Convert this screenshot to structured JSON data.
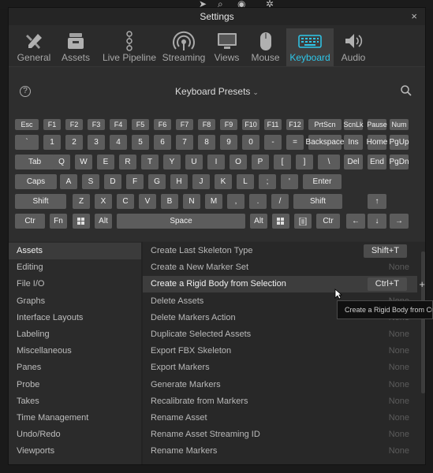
{
  "window": {
    "title": "Settings",
    "close": "×"
  },
  "tabs": [
    {
      "label": "General",
      "icon": "tools-icon"
    },
    {
      "label": "Assets",
      "icon": "assets-icon"
    },
    {
      "label": "Live Pipeline",
      "icon": "pipeline-icon"
    },
    {
      "label": "Streaming",
      "icon": "streaming-icon"
    },
    {
      "label": "Views",
      "icon": "monitor-icon"
    },
    {
      "label": "Mouse",
      "icon": "mouse-icon"
    },
    {
      "label": "Keyboard",
      "icon": "keyboard-icon",
      "active": true
    },
    {
      "label": "Audio",
      "icon": "speaker-icon"
    }
  ],
  "keyboard": {
    "help": "?",
    "presets_label": "Keyboard Presets",
    "rows": [
      [
        "Esc",
        "F1",
        "F2",
        "F3",
        "F4",
        "F5",
        "F6",
        "F7",
        "F8",
        "F9",
        "F10",
        "F11",
        "F12",
        "PrtScn",
        "ScnLk",
        "Pause",
        "Num"
      ],
      [
        "`",
        "1",
        "2",
        "3",
        "4",
        "5",
        "6",
        "7",
        "8",
        "9",
        "0",
        "-",
        "=",
        "Backspace",
        "Ins",
        "Home",
        "PgUp"
      ],
      [
        "Tab",
        "Q",
        "W",
        "E",
        "R",
        "T",
        "Y",
        "U",
        "I",
        "O",
        "P",
        "[",
        "]",
        "\\",
        "Del",
        "End",
        "PgDn"
      ],
      [
        "Caps",
        "A",
        "S",
        "D",
        "F",
        "G",
        "H",
        "J",
        "K",
        "L",
        ";",
        "'",
        "Enter"
      ],
      [
        "Shift",
        "Z",
        "X",
        "C",
        "V",
        "B",
        "N",
        "M",
        ",",
        ".",
        "/",
        "Shift",
        "↑"
      ],
      [
        "Ctr",
        "Fn",
        "win",
        "Alt",
        "Space",
        "Alt",
        "win",
        "menu",
        "Ctr",
        "←",
        "↓",
        "→"
      ]
    ]
  },
  "categories": [
    {
      "label": "Assets",
      "selected": true
    },
    {
      "label": "Editing"
    },
    {
      "label": "File I/O"
    },
    {
      "label": "Graphs"
    },
    {
      "label": "Interface Layouts"
    },
    {
      "label": "Labeling"
    },
    {
      "label": "Miscellaneous"
    },
    {
      "label": "Panes"
    },
    {
      "label": "Probe"
    },
    {
      "label": "Takes"
    },
    {
      "label": "Time Management"
    },
    {
      "label": "Undo/Redo"
    },
    {
      "label": "Viewports"
    }
  ],
  "actions": [
    {
      "label": "Create Last Skeleton Type",
      "shortcut": "Shift+T",
      "set": true
    },
    {
      "label": "Create a New Marker Set",
      "shortcut": "None"
    },
    {
      "label": "Create a Rigid Body from Selection",
      "shortcut": "Ctrl+T",
      "set": true,
      "selected": true
    },
    {
      "label": "Delete Assets",
      "shortcut": "None"
    },
    {
      "label": "Delete Markers Action",
      "shortcut": "None"
    },
    {
      "label": "Duplicate Selected Assets",
      "shortcut": "None"
    },
    {
      "label": "Export FBX Skeleton",
      "shortcut": "None"
    },
    {
      "label": "Export Markers",
      "shortcut": "None"
    },
    {
      "label": "Generate Markers",
      "shortcut": "None"
    },
    {
      "label": "Recalibrate from Markers",
      "shortcut": "None"
    },
    {
      "label": "Rename Asset",
      "shortcut": "None"
    },
    {
      "label": "Rename Asset Streaming ID",
      "shortcut": "None"
    },
    {
      "label": "Rename Markers",
      "shortcut": "None"
    }
  ],
  "add_shortcut": "+",
  "tooltip": "Create a Rigid Body from Cu",
  "colors": {
    "accent": "#2ec7ea",
    "key": "#5c5c5c",
    "panel": "#2b2b2b"
  }
}
